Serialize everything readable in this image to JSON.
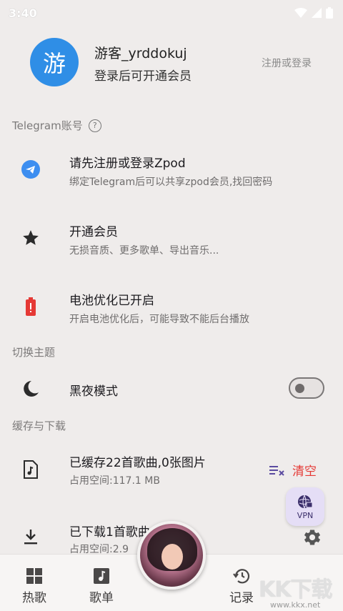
{
  "status_bar": {
    "time": "3:40"
  },
  "profile": {
    "avatar_char": "游",
    "name": "游客_yrddokuj",
    "subtitle": "登录后可开通会员",
    "login_link": "注册或登录"
  },
  "sections": {
    "telegram": "Telegram账号",
    "theme": "切换主题",
    "cache": "缓存与下载"
  },
  "rows": {
    "telegram": {
      "title": "请先注册或登录Zpod",
      "sub": "绑定Telegram后可以共享zpod会员,找回密码"
    },
    "vip": {
      "title": "开通会员",
      "sub": "无损音质、更多歌单、导出音乐..."
    },
    "battery": {
      "title": "电池优化已开启",
      "sub": "开启电池优化后，可能导致不能后台播放"
    },
    "dark": {
      "title": "黑夜模式"
    },
    "cached": {
      "title": "已缓存22首歌曲,0张图片",
      "sub": "占用空间:117.1 MB"
    },
    "downloaded": {
      "title": "已下载1首歌曲",
      "sub": "占用空间:2.9"
    }
  },
  "dark_mode_on": false,
  "clear_label": "清空",
  "vpn_label": "VPN",
  "nav": {
    "hot": "热歌",
    "playlist": "歌单",
    "history": "记录"
  },
  "watermark": {
    "logo": "KK下载",
    "url": "www.kkx.net"
  },
  "colors": {
    "accent": "#2f8ee6",
    "danger": "#e53935",
    "vpn_bg": "#e5def6"
  }
}
